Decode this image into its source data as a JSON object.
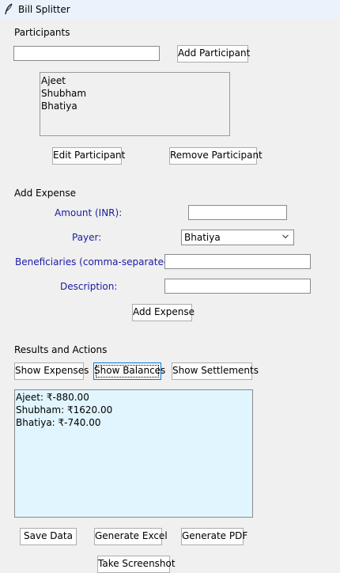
{
  "window": {
    "title": "Bill Splitter",
    "icon": "feather-icon"
  },
  "participants": {
    "section_label": "Participants",
    "name_input_value": "",
    "add_button": "Add Participant",
    "list": [
      "Ajeet",
      "Shubham",
      "Bhatiya"
    ],
    "edit_button": "Edit Participant",
    "remove_button": "Remove Participant"
  },
  "expense": {
    "section_label": "Add Expense",
    "amount_label": "Amount (INR):",
    "amount_value": "",
    "payer_label": "Payer:",
    "payer_selected": "Bhatiya",
    "beneficiaries_label": "Beneficiaries (comma-separated):",
    "beneficiaries_value": "",
    "description_label": "Description:",
    "description_value": "",
    "add_button": "Add Expense"
  },
  "results": {
    "section_label": "Results and Actions",
    "show_expenses": "Show Expenses",
    "show_balances": "Show Balances",
    "show_settlements": "Show Settlements",
    "lines": [
      "Ajeet: ₹-880.00",
      "Shubham: ₹1620.00",
      "Bhatiya: ₹-740.00"
    ],
    "save_data": "Save Data",
    "generate_excel": "Generate Excel",
    "generate_pdf": "Generate PDF",
    "take_screenshot": "Take Screenshot"
  },
  "colors": {
    "label_blue": "#1a1aa6",
    "results_bg": "#e1f5fe",
    "titlebar_bg": "#eaf2fb"
  }
}
